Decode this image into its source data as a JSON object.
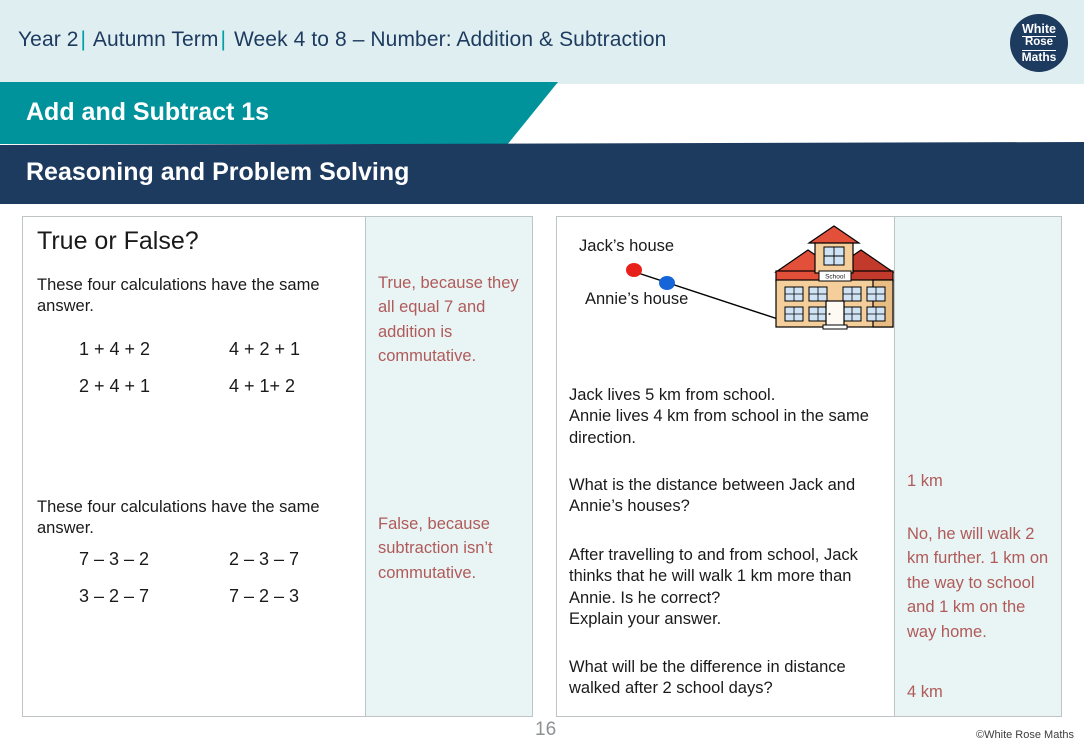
{
  "header": {
    "year": "Year 2",
    "term": "Autumn Term",
    "week": "Week 4 to 8 – Number: Addition & Subtraction",
    "separator": "|",
    "logo": {
      "line1": "White",
      "line2": "Rose",
      "line3": "Maths"
    }
  },
  "banners": {
    "topic": "Add and Subtract 1s",
    "section": "Reasoning and Problem Solving",
    "teal_color": "#00939b",
    "navy_color": "#1d3a5f"
  },
  "left_panel": {
    "title": "True or False?",
    "stem1": "These four calculations have the same answer.",
    "calculations1": [
      "1 + 4 + 2",
      "4 + 2 + 1",
      "2 + 4 + 1",
      "4 + 1+ 2"
    ],
    "stem2": "These four calculations have the same answer.",
    "calculations2": [
      "7 – 3 – 2",
      "2 – 3 – 7",
      "3 – 2 – 7",
      "7 – 2 – 3"
    ],
    "answer1": "True, because they all equal 7 and addition is commutative.",
    "answer2": "False, because subtraction isn’t commutative."
  },
  "right_panel": {
    "label_jack": "Jack’s house",
    "label_annie": "Annie’s house",
    "school_sign": "School",
    "question1": "Jack lives 5 km from school.\nAnnie lives 4 km from school in the same direction.",
    "question2": "What is the distance between Jack and Annie’s houses?",
    "question3": "After travelling to and from school, Jack thinks that he will walk 1 km more than Annie. Is he correct?\nExplain your answer.",
    "question4": "What will be the difference in distance walked after 2 school days?",
    "answer1": "1 km",
    "answer2": "No, he will walk 2 km further. 1 km on the way to school and 1 km on the way home.",
    "answer3": "4 km"
  },
  "footer": {
    "page_number": "16",
    "copyright": "©White Rose Maths"
  },
  "colors": {
    "answer_text": "#b05a5a",
    "answer_background": "#e9f4f4",
    "header_background": "#dfeef0",
    "jack_dot": "#e8201a",
    "annie_dot": "#1565d8"
  }
}
